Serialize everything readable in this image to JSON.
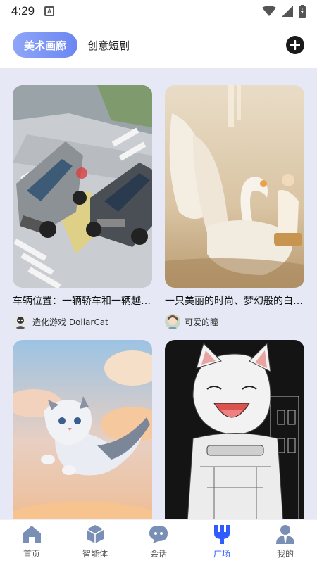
{
  "status": {
    "time": "4:29",
    "indicator": "A"
  },
  "header": {
    "tabs": [
      {
        "label": "美术画廊",
        "active": true
      },
      {
        "label": "创意短剧",
        "active": false
      }
    ],
    "add_icon": "plus-circle-icon"
  },
  "cards": [
    {
      "title": "车辆位置：一辆轿车和一辆越野车…",
      "author": "造化游戏 DollarCat",
      "image": "car-accident-illustration"
    },
    {
      "title": "一只美丽的时尚、梦幻般的白天鹅…",
      "author": "可爱的瞳",
      "image": "swan-princess-illustration"
    },
    {
      "title": "",
      "author": "",
      "image": "flying-kitten-clouds"
    },
    {
      "title": "",
      "author": "",
      "image": "laughing-cat-sketch"
    }
  ],
  "nav": {
    "items": [
      {
        "label": "首页",
        "icon": "home-icon",
        "active": false
      },
      {
        "label": "智能体",
        "icon": "cube-icon",
        "active": false
      },
      {
        "label": "会话",
        "icon": "chat-icon",
        "active": false
      },
      {
        "label": "广场",
        "icon": "plaza-icon",
        "active": true
      },
      {
        "label": "我的",
        "icon": "profile-icon",
        "active": false
      }
    ]
  },
  "colors": {
    "accent": "#2f5bff",
    "tab_gradient_start": "#8fa6f7",
    "tab_gradient_end": "#6b86f2",
    "content_bg": "#e6e9f5",
    "nav_icon_inactive": "#7a8fb5"
  }
}
